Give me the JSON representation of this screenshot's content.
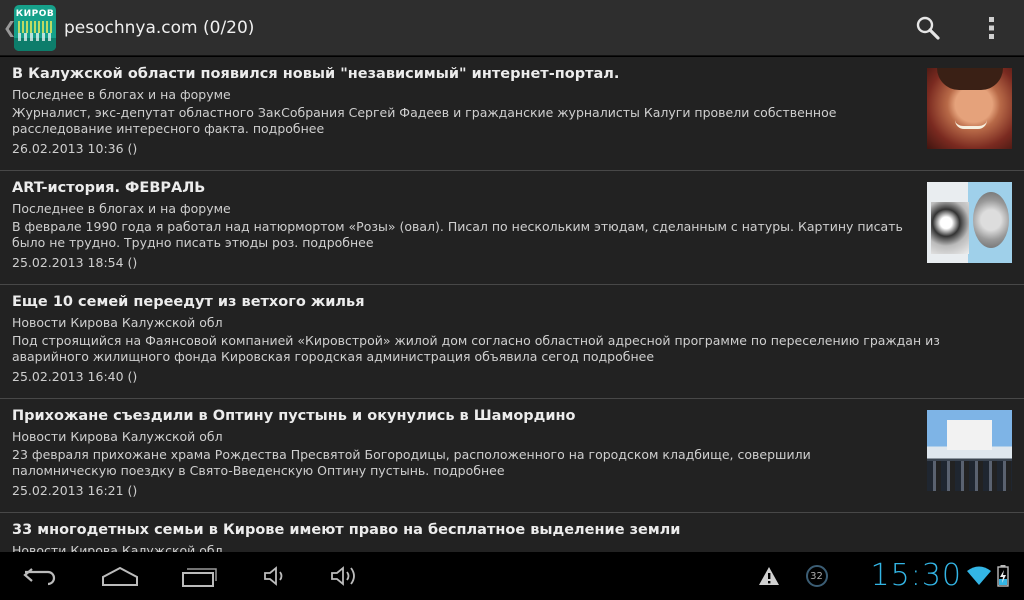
{
  "actionbar": {
    "title": "pesochnya.com (0/20)",
    "logo_text": "КИРОВ",
    "search_icon": "search-icon",
    "overflow_icon": "overflow-menu-icon"
  },
  "items": [
    {
      "title": "В Калужской области появился новый \"независимый\" интернет-портал.",
      "source": "Последнее в блогах и на форуме",
      "desc": "Журналист, экс-депутат областного ЗакСобрания Сергей Фадеев и гражданские журналисты Калуги провели собственное расследование интересного факта. подробнее",
      "date": "26.02.2013 10:36 ()",
      "thumb": "face"
    },
    {
      "title": "ART-история. ФЕВРАЛЬ",
      "source": "Последнее в блогах и на форуме",
      "desc": "В феврале 1990 года я работал над натюрмортом «Розы» (овал). Писал по нескольким этюдам, сделанным с натуры. Картину писать было не трудно. Трудно писать этюды роз. подробнее",
      "date": "25.02.2013 18:54 ()",
      "thumb": "art"
    },
    {
      "title": "Еще 10 семей переедут из ветхого жилья",
      "source": "Новости Кирова Калужской обл",
      "desc": "Под строящийся на Фаянсовой компанией «Кировстрой» жилой дом согласно областной адресной программе по переселению граждан из аварийного жилищного фонда Кировская городская администрация объявила сегод подробнее",
      "date": "25.02.2013 16:40 ()",
      "thumb": ""
    },
    {
      "title": "Прихожане съездили в Оптину пустынь и окунулись в Шамордино",
      "source": "Новости Кирова Калужской обл",
      "desc": "23 февраля прихожане храма Рождества Пресвятой Богородицы, расположенного на городском кладбище, совершили паломническую поездку в Свято-Введенскую Оптину пустынь. подробнее",
      "date": "25.02.2013 16:21 ()",
      "thumb": "church"
    },
    {
      "title": "33 многодетных семьи в Кирове имеют право на бесплатное выделение земли",
      "source": "Новости Кирова Калужской обл",
      "desc": "",
      "date": "",
      "thumb": ""
    }
  ],
  "systembar": {
    "clock": "15:30",
    "notification_count": "32",
    "colors": {
      "clock": "#33b5e5",
      "accent": "#33b5e5"
    }
  }
}
